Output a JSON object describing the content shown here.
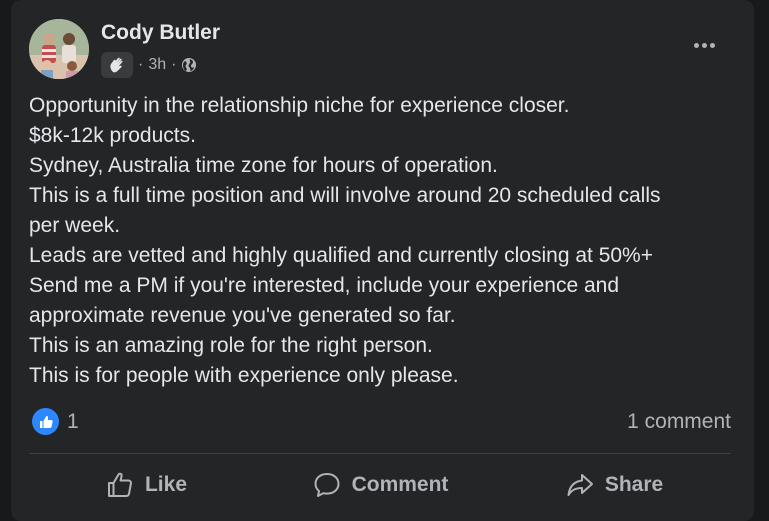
{
  "post": {
    "author": "Cody Butler",
    "time": "3h",
    "separator": "·",
    "audience_icon": "globe-icon",
    "badge_icon": "wave-hand-icon",
    "body_lines": [
      "Opportunity in the relationship niche for experience closer.",
      "$8k-12k products.",
      "Sydney, Australia time zone for hours of operation.",
      "This is a full time position and will involve around 20 scheduled calls",
      "per week.",
      "Leads are vetted and highly qualified and currently closing at 50%+",
      "Send me a PM if you're interested, include your experience and",
      "approximate revenue you've generated so far.",
      "This is an amazing role for the right person.",
      "This is for people with experience only please."
    ]
  },
  "stats": {
    "reaction_icon": "like-reaction-icon",
    "like_count": "1",
    "comments": "1 comment"
  },
  "actions": {
    "like": "Like",
    "comment": "Comment",
    "share": "Share"
  },
  "colors": {
    "background": "#242526",
    "text": "#e4e6eb",
    "secondary": "#b0b3b8",
    "like_blue": "#2d88ff"
  }
}
